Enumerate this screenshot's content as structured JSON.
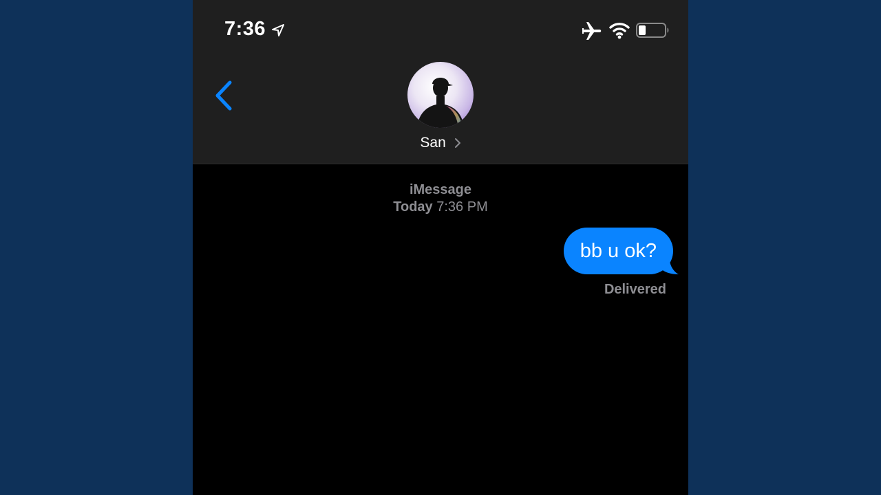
{
  "status_bar": {
    "time": "7:36",
    "icons": [
      "location-arrow-icon",
      "airplane-icon",
      "wifi-icon",
      "battery-icon"
    ]
  },
  "nav": {
    "back_icon": "chevron-left-icon",
    "contact_name": "San",
    "contact_chevron": "chevron-right-icon"
  },
  "conversation": {
    "service": "iMessage",
    "timestamp_day": "Today",
    "timestamp_time": "7:36 PM",
    "messages": [
      {
        "direction": "sent",
        "text": "bb u ok?",
        "status": "Delivered"
      }
    ]
  },
  "colors": {
    "background_outer": "#0e3159",
    "header": "#1f1f1f",
    "screen": "#000000",
    "accent_blue": "#0a84ff",
    "secondary_text": "#8e8e93"
  }
}
